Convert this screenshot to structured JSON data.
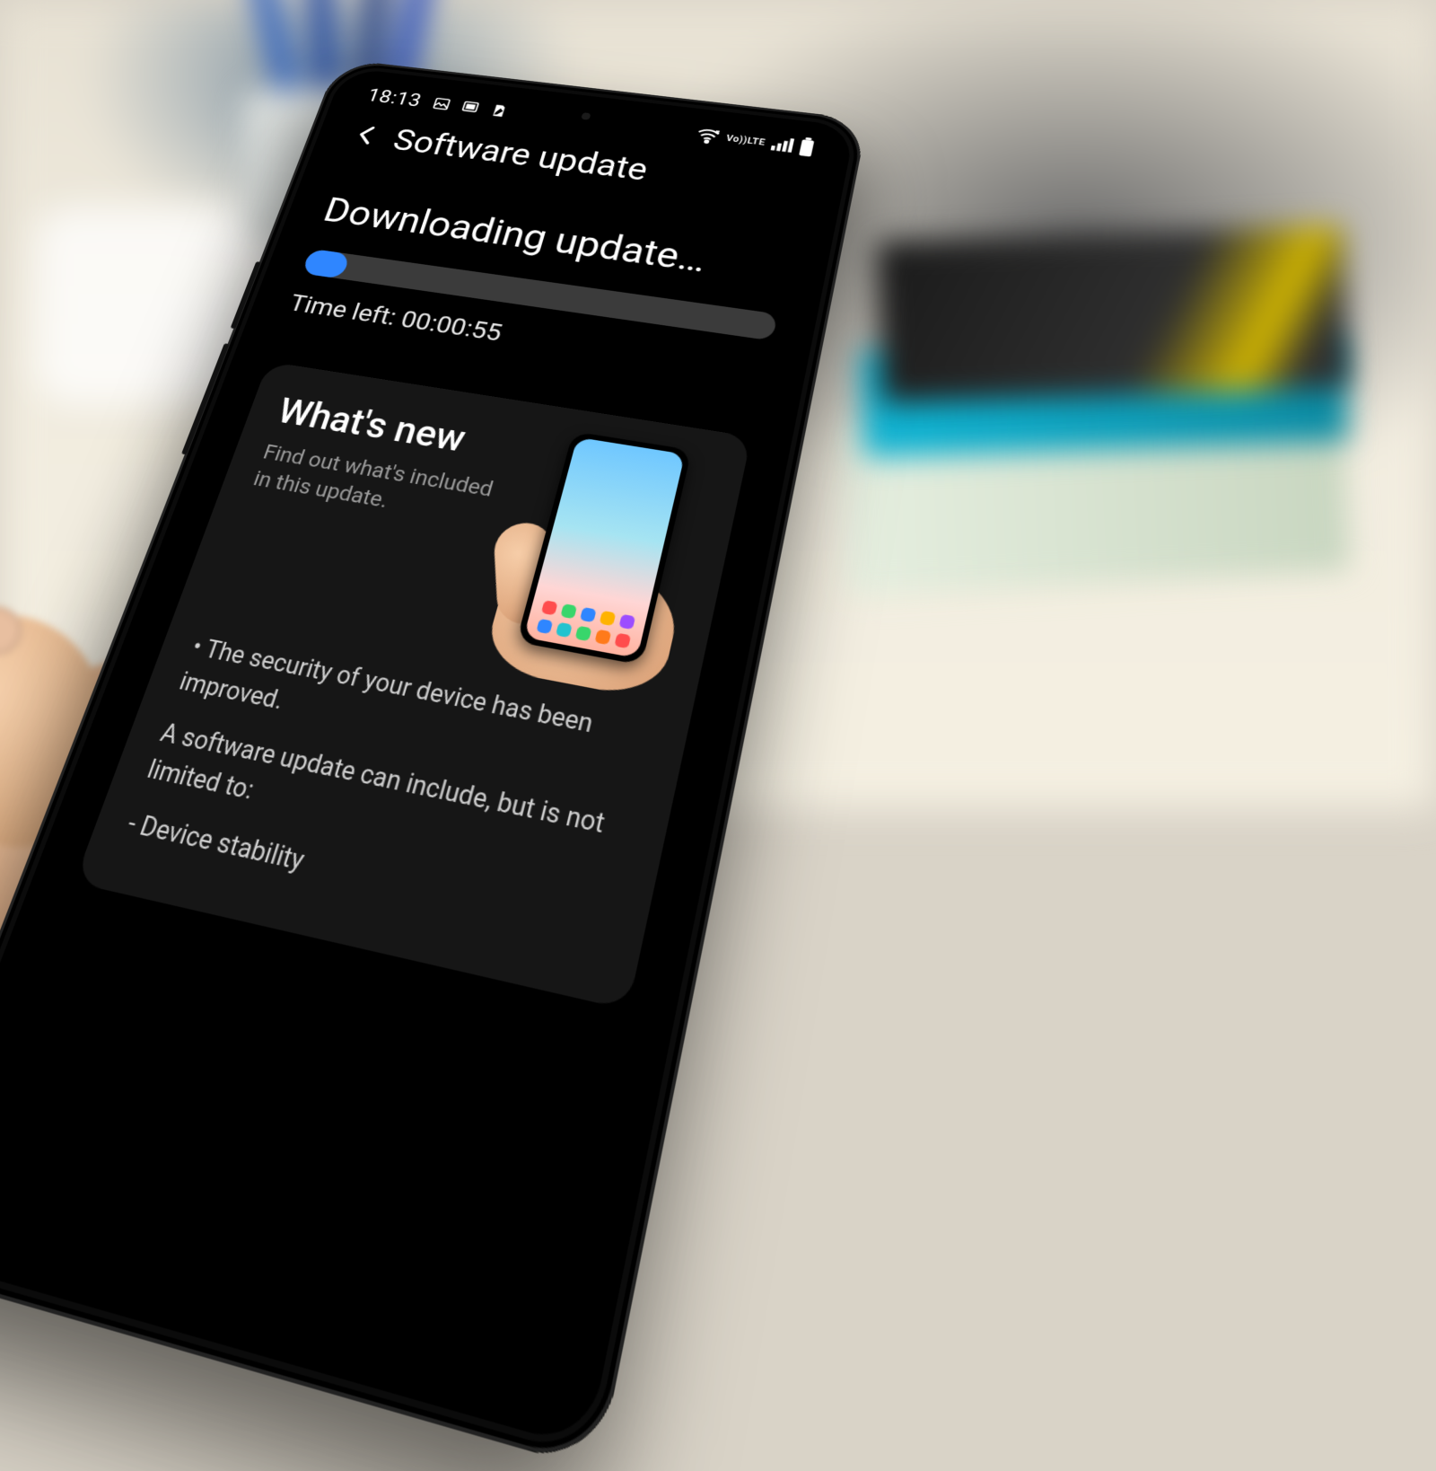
{
  "statusbar": {
    "time": "18:13",
    "left_icons": [
      "image-icon",
      "cast-icon",
      "note-icon"
    ],
    "right_icons": {
      "wifi": "wifi-icon",
      "volte_top": "Vo))",
      "volte_bottom": "LTE",
      "signal": "signal-icon",
      "battery": "battery-icon"
    }
  },
  "header": {
    "back_icon": "back-icon",
    "title": "Software update"
  },
  "download": {
    "heading": "Downloading update…",
    "progress_percent": 9,
    "time_left_label": "Time left: 00:00:55"
  },
  "whatsnew": {
    "title": "What's new",
    "subtitle": "Find out what's included in this update.",
    "bullet1": "• The security of your device has been improved.",
    "body_line2": "A software update can include, but is not limited to:",
    "dash1": "- Device stability",
    "illustration": "hand-holding-phone"
  },
  "colors": {
    "accent": "#2f86ff",
    "track": "#3b3b3b",
    "card": "#161616",
    "muted": "#9a9a9a"
  }
}
